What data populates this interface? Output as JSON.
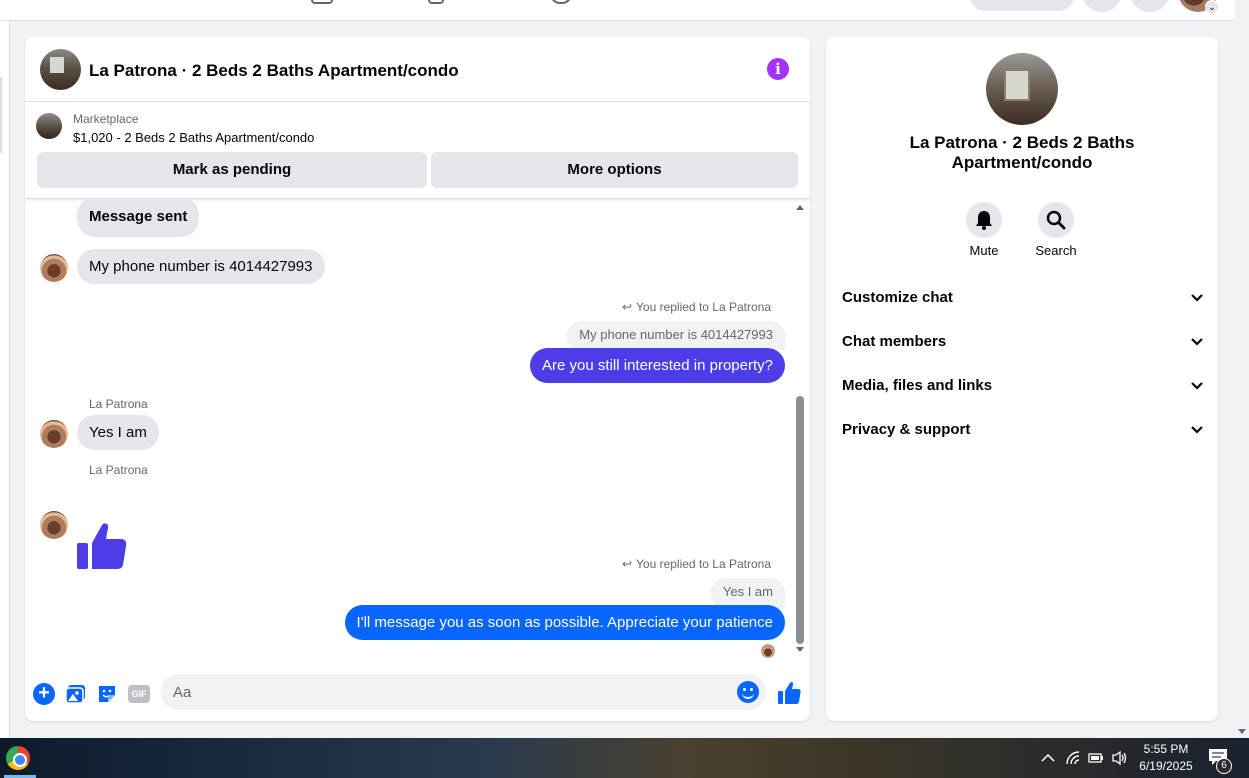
{
  "chat": {
    "header_title": "La Patrona · 2 Beds 2 Baths Apartment/condo",
    "info_icon": "i"
  },
  "marketplace": {
    "label": "Marketplace",
    "listing": "$1,020 - 2 Beds 2 Baths Apartment/condo",
    "pending_button": "Mark as pending",
    "more_button": "More options"
  },
  "messages": {
    "msg1": "Message sent",
    "msg2": "My phone number is 4014427993",
    "reply1_meta": "You replied to La Patrona",
    "reply1_quote": "My phone number is 4014427993",
    "reply1_text": "Are you still interested in property?",
    "sender1": "La Patrona",
    "msg3": "Yes I am",
    "sender2": "La Patrona",
    "reply2_meta": "You replied to La Patrona",
    "reply2_quote": "Yes I am",
    "reply2_text": "I'll message you as soon as possible. Appreciate your patience"
  },
  "composer": {
    "placeholder": "Aa",
    "gif_label": "GIF",
    "plus_label": "+"
  },
  "info_panel": {
    "title": "La Patrona · 2 Beds 2 Baths Apartment/condo",
    "mute_label": "Mute",
    "search_label": "Search",
    "rows": [
      "Customize chat",
      "Chat members",
      "Media, files and links",
      "Privacy & support"
    ]
  },
  "taskbar": {
    "time": "5:55 PM",
    "date": "6/19/2025",
    "notification_count": "6"
  },
  "colors": {
    "purple_bubble": "#4c3de8",
    "blue_bubble": "#0866ff",
    "info_icon": "#a033ff"
  }
}
